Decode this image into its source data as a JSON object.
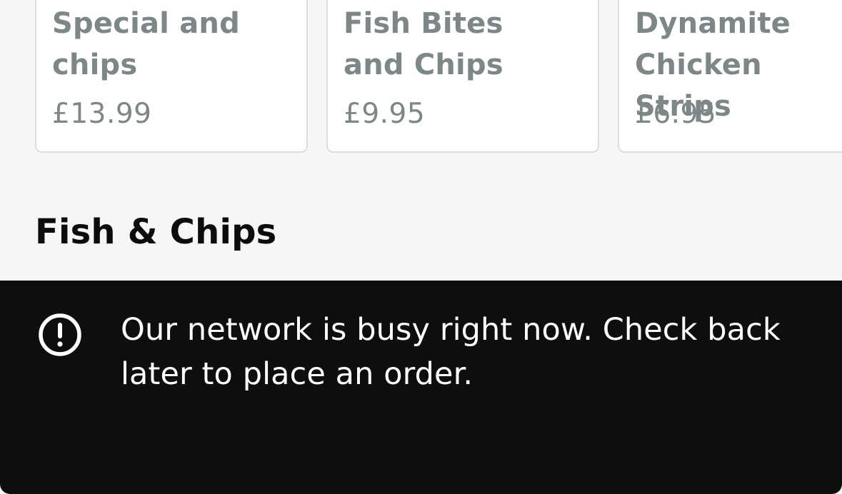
{
  "menu": {
    "items": [
      {
        "title": "Special and chips",
        "price": "£13.99"
      },
      {
        "title": "Fish Bites and Chips",
        "price": "£9.95"
      },
      {
        "title": "Dynamite Chicken Strips",
        "price": "£6.95"
      }
    ],
    "section_title": "Fish & Chips"
  },
  "banner": {
    "icon": "exclamation-circle-icon",
    "message": "Our network is busy right now. Check back later to place an order."
  }
}
